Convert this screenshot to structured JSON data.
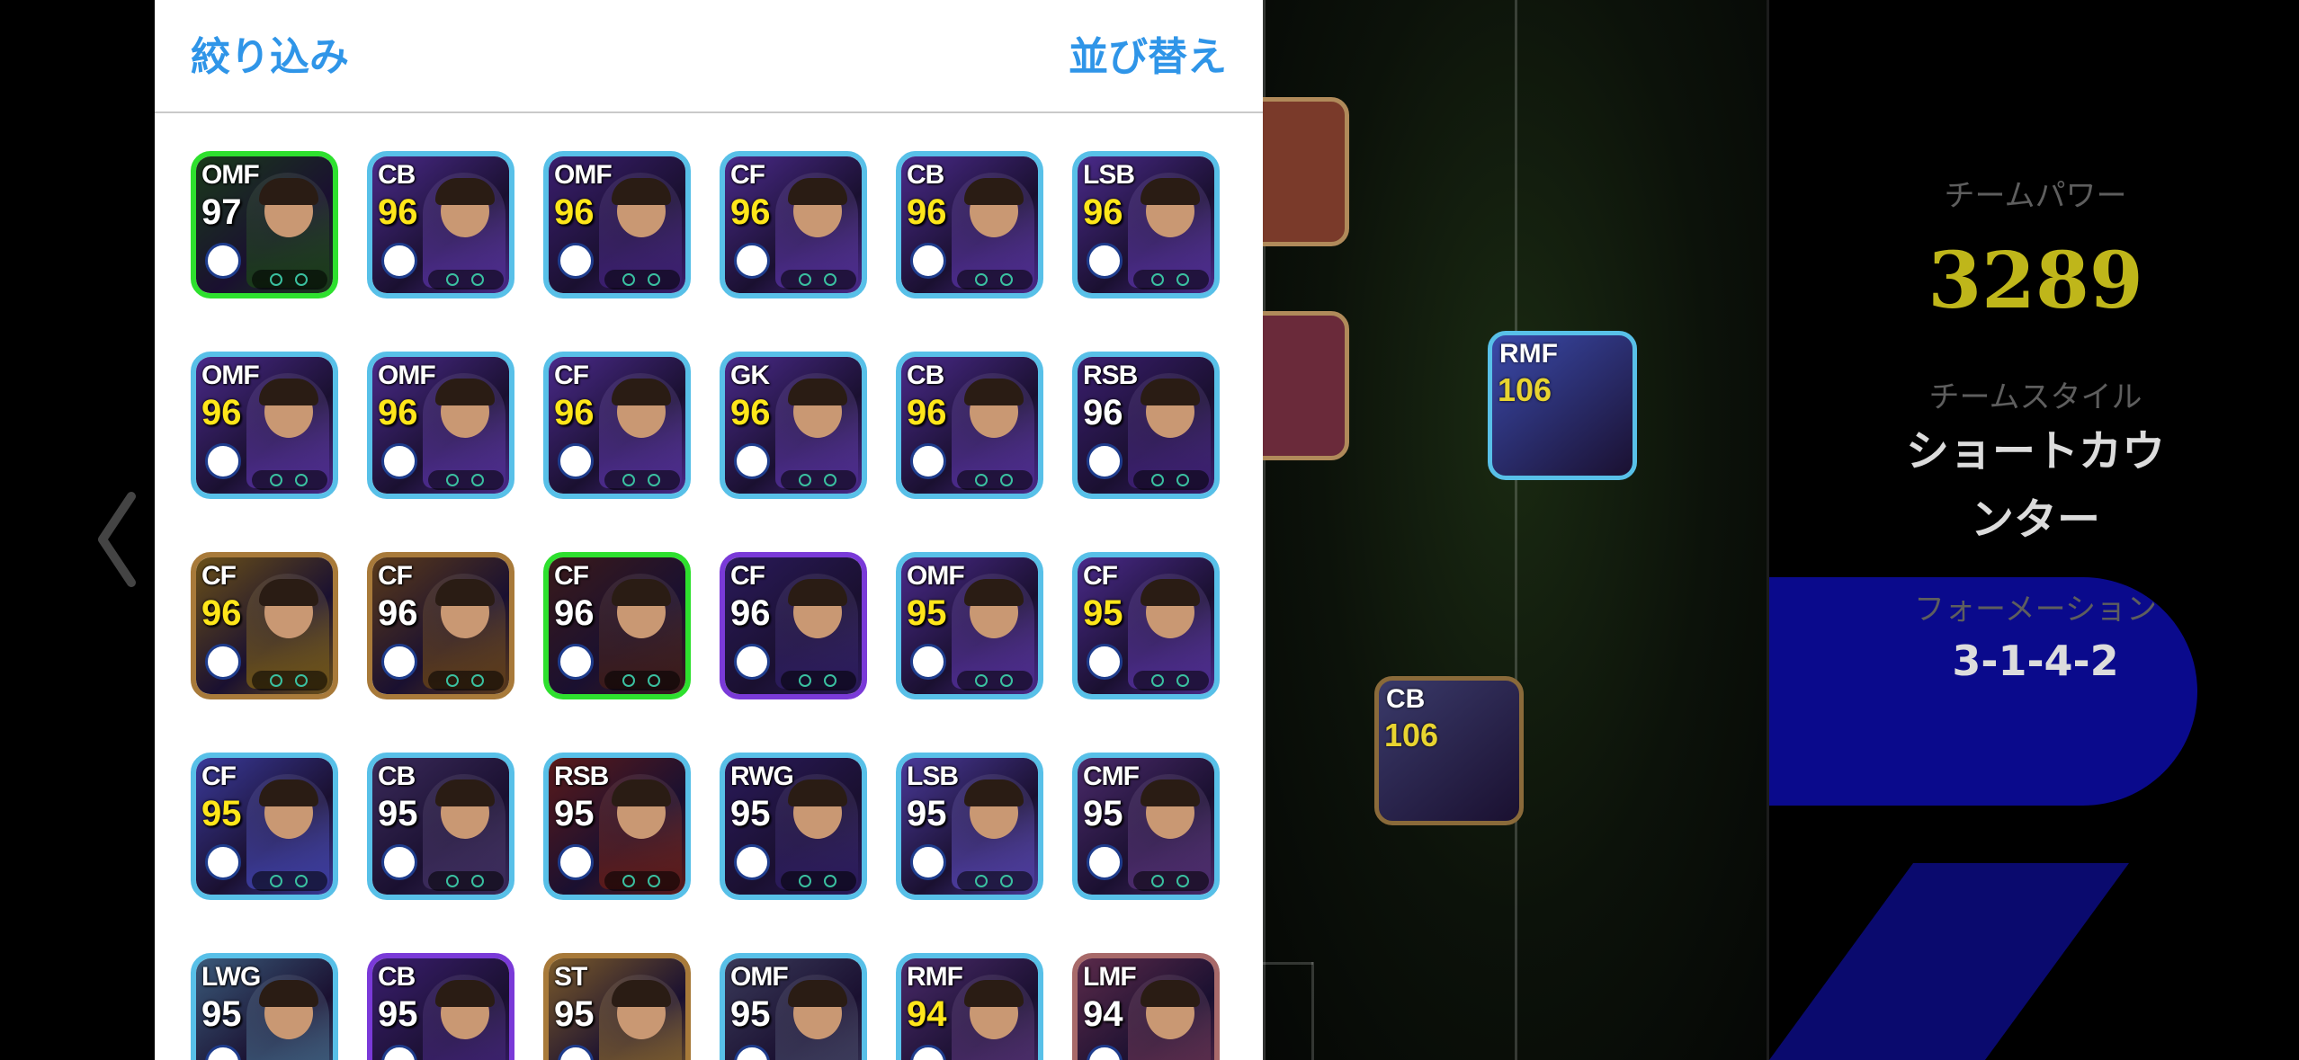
{
  "panel": {
    "filter_label": "絞り込み",
    "sort_label": "並び替え"
  },
  "cards": [
    {
      "pos": "OMF",
      "rating": "97",
      "gold": false,
      "border": "#2ee02e",
      "bg": "#1a3a1a"
    },
    {
      "pos": "CB",
      "rating": "96",
      "gold": true,
      "border": "#58c0e8",
      "bg": "#4a2a8a"
    },
    {
      "pos": "OMF",
      "rating": "96",
      "gold": true,
      "border": "#58c0e8",
      "bg": "#3a1e6e"
    },
    {
      "pos": "CF",
      "rating": "96",
      "gold": true,
      "border": "#58c0e8",
      "bg": "#4a2a8a"
    },
    {
      "pos": "CB",
      "rating": "96",
      "gold": true,
      "border": "#58c0e8",
      "bg": "#4a2a8a"
    },
    {
      "pos": "LSB",
      "rating": "96",
      "gold": true,
      "border": "#58c0e8",
      "bg": "#4a2a8a"
    },
    {
      "pos": "OMF",
      "rating": "96",
      "gold": true,
      "border": "#58c0e8",
      "bg": "#4a2a8a"
    },
    {
      "pos": "OMF",
      "rating": "96",
      "gold": true,
      "border": "#58c0e8",
      "bg": "#4a2a8a"
    },
    {
      "pos": "CF",
      "rating": "96",
      "gold": true,
      "border": "#58c0e8",
      "bg": "#4a2a8a"
    },
    {
      "pos": "GK",
      "rating": "96",
      "gold": true,
      "border": "#58c0e8",
      "bg": "#4a2a8a"
    },
    {
      "pos": "CB",
      "rating": "96",
      "gold": true,
      "border": "#58c0e8",
      "bg": "#4a2a8a"
    },
    {
      "pos": "RSB",
      "rating": "96",
      "gold": false,
      "border": "#58c0e8",
      "bg": "#3a1e6e"
    },
    {
      "pos": "CF",
      "rating": "96",
      "gold": true,
      "border": "#a87a3a",
      "bg": "#6a5018"
    },
    {
      "pos": "CF",
      "rating": "96",
      "gold": false,
      "border": "#a87a3a",
      "bg": "#5a3a1a"
    },
    {
      "pos": "CF",
      "rating": "96",
      "gold": false,
      "border": "#2ee02e",
      "bg": "#3a1a1a"
    },
    {
      "pos": "CF",
      "rating": "96",
      "gold": false,
      "border": "#7a3ad8",
      "bg": "#2a1a5a"
    },
    {
      "pos": "OMF",
      "rating": "95",
      "gold": true,
      "border": "#58c0e8",
      "bg": "#4a2a8a"
    },
    {
      "pos": "CF",
      "rating": "95",
      "gold": true,
      "border": "#58c0e8",
      "bg": "#4a2a8a"
    },
    {
      "pos": "CF",
      "rating": "95",
      "gold": true,
      "border": "#58c0e8",
      "bg": "#3a3a9a"
    },
    {
      "pos": "CB",
      "rating": "95",
      "gold": false,
      "border": "#58c0e8",
      "bg": "#3a2a5a"
    },
    {
      "pos": "RSB",
      "rating": "95",
      "gold": false,
      "border": "#58c0e8",
      "bg": "#5a1a1a"
    },
    {
      "pos": "RWG",
      "rating": "95",
      "gold": false,
      "border": "#58c0e8",
      "bg": "#2a1a5a"
    },
    {
      "pos": "LSB",
      "rating": "95",
      "gold": false,
      "border": "#58c0e8",
      "bg": "#4a3a9a"
    },
    {
      "pos": "CMF",
      "rating": "95",
      "gold": false,
      "border": "#58c0e8",
      "bg": "#4a2a6a"
    },
    {
      "pos": "LWG",
      "rating": "95",
      "gold": false,
      "border": "#58c0e8",
      "bg": "#3a5a7a"
    },
    {
      "pos": "CB",
      "rating": "95",
      "gold": false,
      "border": "#7a3ad8",
      "bg": "#3a1e6e"
    },
    {
      "pos": "ST",
      "rating": "95",
      "gold": false,
      "border": "#a87a3a",
      "bg": "#7a5a2a"
    },
    {
      "pos": "OMF",
      "rating": "95",
      "gold": false,
      "border": "#58c0e8",
      "bg": "#3a3a5a"
    },
    {
      "pos": "RMF",
      "rating": "94",
      "gold": true,
      "border": "#58c0e8",
      "bg": "#4a2a6a"
    },
    {
      "pos": "LMF",
      "rating": "94",
      "gold": false,
      "border": "#a86a6a",
      "bg": "#5a2a4a"
    }
  ],
  "pitch_cards": [
    {
      "pos": "RMF",
      "rating": "106",
      "border": "#58c0e8",
      "bg": "#3a4aaa"
    },
    {
      "pos": "CB",
      "rating": "106",
      "border": "#8a6a3a",
      "bg": "#3a3a6a"
    }
  ],
  "info": {
    "team_power_label": "チームパワー",
    "team_power_value": "3289",
    "team_style_label": "チームスタイル",
    "team_style_value_line1": "ショートカウ",
    "team_style_value_line2": "ンター",
    "formation_label": "フォーメーション",
    "formation_value": "3-1-4-2"
  },
  "colors": {
    "accent": "#2f95e8",
    "team_power": "#bfb61a",
    "formation_bg": "#0a0a8c"
  }
}
